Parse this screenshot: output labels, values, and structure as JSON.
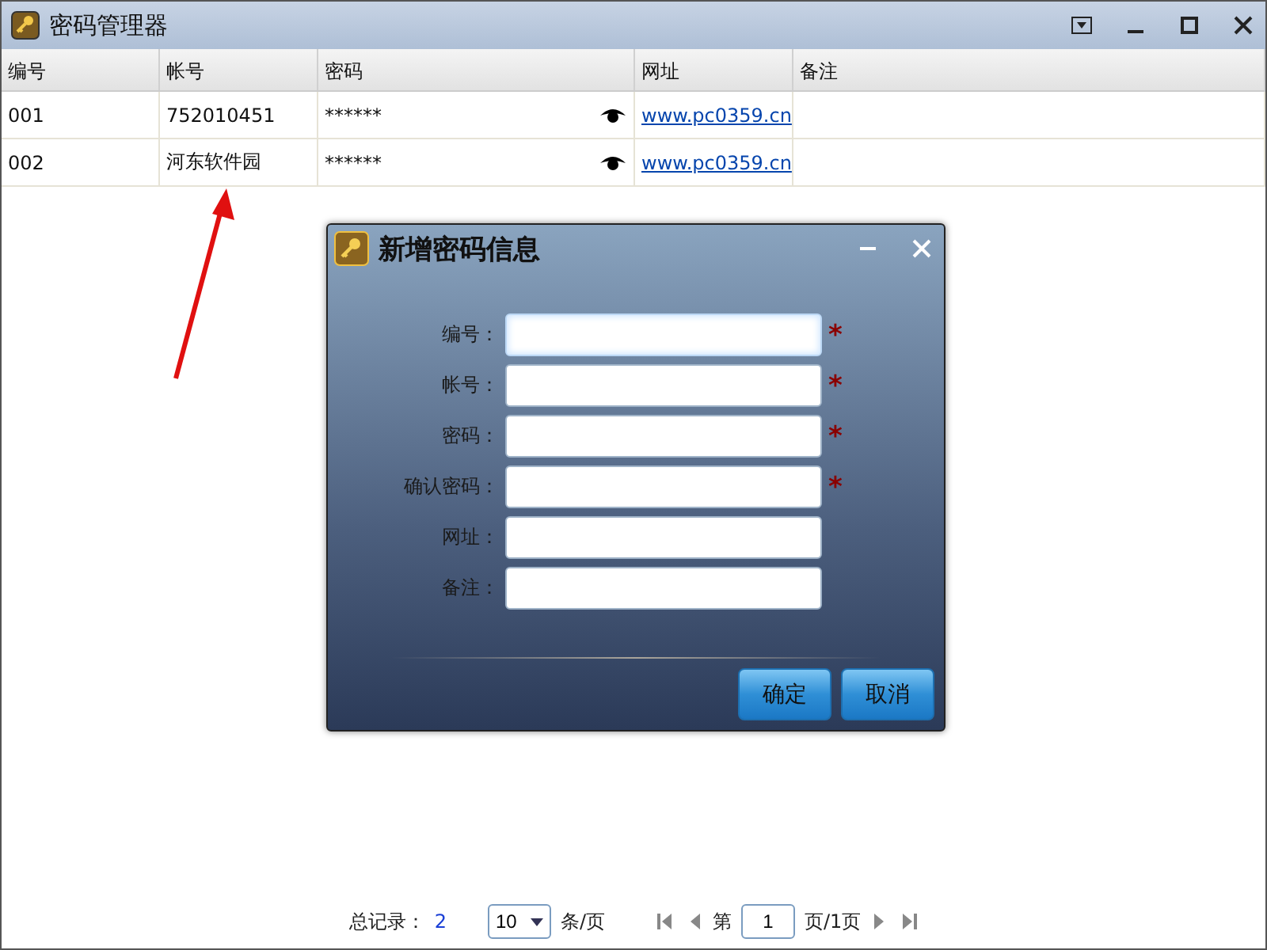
{
  "window": {
    "title": "密码管理器"
  },
  "table": {
    "columns": [
      "编号",
      "帐号",
      "密码",
      "网址",
      "备注"
    ],
    "rows": [
      {
        "cells": [
          "001",
          "752010451",
          "******",
          "www.pc0359.cn",
          ""
        ]
      },
      {
        "cells": [
          "002",
          "河东软件园",
          "******",
          "www.pc0359.cn",
          ""
        ]
      }
    ]
  },
  "dialog": {
    "title": "新增密码信息",
    "fields": [
      {
        "label": "编号：",
        "required": true,
        "focused": true
      },
      {
        "label": "帐号：",
        "required": true,
        "focused": false
      },
      {
        "label": "密码：",
        "required": true,
        "focused": false
      },
      {
        "label": "确认密码：",
        "required": true,
        "focused": false
      },
      {
        "label": "网址：",
        "required": false,
        "focused": false
      },
      {
        "label": "备注：",
        "required": false,
        "focused": false
      }
    ],
    "required_mark": "*",
    "buttons": [
      "确定",
      "取消"
    ]
  },
  "pagination": {
    "total_label": "总记录：",
    "total": "2",
    "page_size": "10",
    "per_page": "条/页",
    "page_prefix": "第",
    "page": "1",
    "page_suffix": "页/1页"
  }
}
